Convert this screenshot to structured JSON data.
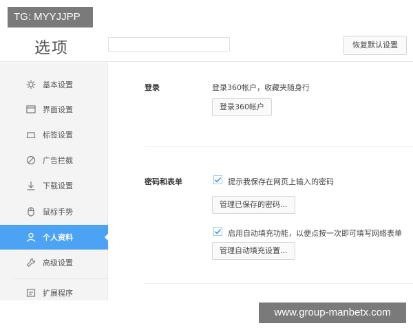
{
  "overlay": {
    "tag": "TG: MYYJJPP",
    "watermark": "www.group-manbetx.com"
  },
  "header": {
    "title": "选项",
    "search_placeholder": "",
    "restore_label": "恢复默认设置"
  },
  "sidebar": {
    "items": [
      {
        "label": "基本设置",
        "icon": "gear-icon"
      },
      {
        "label": "界面设置",
        "icon": "window-icon"
      },
      {
        "label": "标签设置",
        "icon": "tab-icon"
      },
      {
        "label": "广告拦截",
        "icon": "block-icon"
      },
      {
        "label": "下载设置",
        "icon": "download-icon"
      },
      {
        "label": "鼠标手势",
        "icon": "mouse-icon"
      },
      {
        "label": "个人资料",
        "icon": "user-icon"
      },
      {
        "label": "高级设置",
        "icon": "wrench-icon"
      },
      {
        "label": "扩展程序",
        "icon": "extension-icon"
      }
    ],
    "active_index": 6
  },
  "login": {
    "label": "登录",
    "desc": "登录360帐户，收藏夹随身行",
    "button": "登录360帐户"
  },
  "password": {
    "label": "密码和表单",
    "save_prompt": "提示我保存在网页上输入的密码",
    "manage_saved": "管理已保存的密码...",
    "autofill": "启用自动填充功能，以便点按一次即可填写网络表单",
    "manage_autofill": "管理自动填充设置..."
  },
  "colors": {
    "accent": "#4da3f3",
    "checkbox_border": "#9cc8ef",
    "checkmark": "#3b8fe0"
  }
}
